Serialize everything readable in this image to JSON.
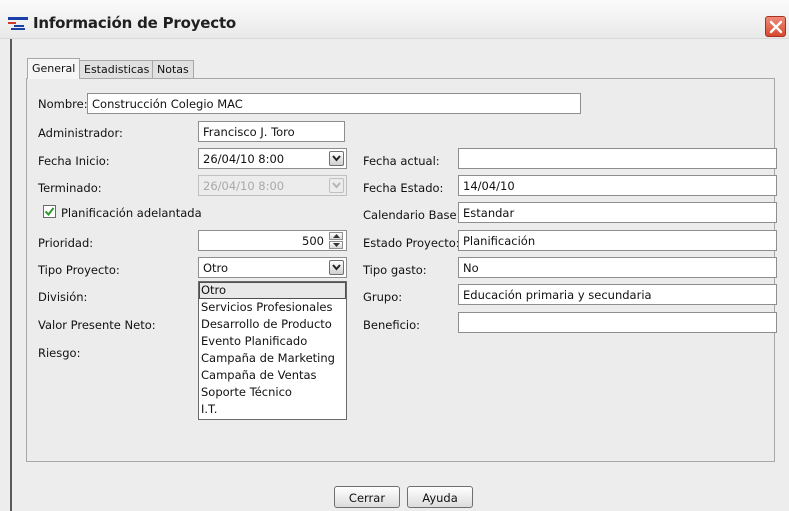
{
  "window": {
    "title": "Información de Proyecto"
  },
  "tabs": [
    {
      "label": "General",
      "active": true
    },
    {
      "label": "Estadisticas",
      "active": false
    },
    {
      "label": "Notas",
      "active": false
    }
  ],
  "form": {
    "nombre": {
      "label": "Nombre:",
      "value": "Construcción Colegio MAC"
    },
    "administrador": {
      "label": "Administrador:",
      "value": "Francisco J. Toro"
    },
    "fecha_inicio": {
      "label": "Fecha Inicio:",
      "value": "26/04/10 8:00"
    },
    "terminado": {
      "label": "Terminado:",
      "value": "26/04/10 8:00"
    },
    "planificacion": {
      "label": "Planificación adelantada",
      "checked": true
    },
    "prioridad": {
      "label": "Prioridad:",
      "value": "500"
    },
    "tipo_proyecto": {
      "label": "Tipo Proyecto:",
      "value": "Otro"
    },
    "division": {
      "label": "División:"
    },
    "valor_presente_neto": {
      "label": "Valor Presente Neto:"
    },
    "riesgo": {
      "label": "Riesgo:"
    },
    "fecha_actual": {
      "label": "Fecha actual:",
      "value": ""
    },
    "fecha_estado": {
      "label": "Fecha Estado:",
      "value": "14/04/10"
    },
    "calendario_base": {
      "label": "Calendario Base:",
      "value": "Estandar"
    },
    "estado_proyecto": {
      "label": "Estado Proyecto:",
      "value": "Planificación"
    },
    "tipo_gasto": {
      "label": "Tipo gasto:",
      "value": "No"
    },
    "grupo": {
      "label": "Grupo:",
      "value": "Educación primaria y secundaria"
    },
    "beneficio": {
      "label": "Beneficio:",
      "value": ""
    }
  },
  "tipo_proyecto_options": [
    "Otro",
    "Servicios Profesionales",
    "Desarrollo de Producto",
    "Evento Planificado",
    "Campaña de Marketing",
    "Campaña de Ventas",
    "Soporte Técnico",
    "I.T."
  ],
  "buttons": {
    "cerrar": "Cerrar",
    "ayuda": "Ayuda"
  },
  "colors": {
    "close_button": "#d6492f",
    "window_bg": "#ededed"
  }
}
